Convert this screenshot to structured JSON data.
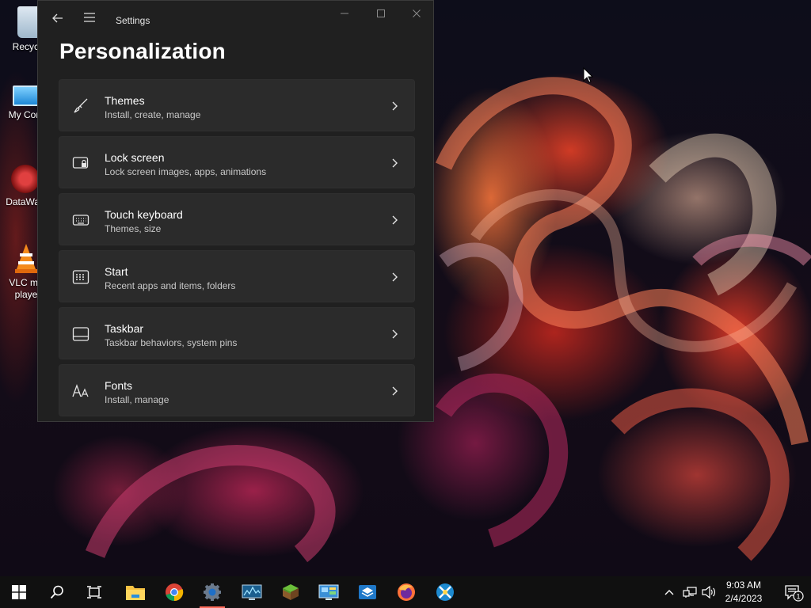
{
  "desktop": {
    "icons": [
      {
        "label": "Recycle",
        "icon": "recycle-bin-icon"
      },
      {
        "label": "My Com",
        "icon": "computer-icon"
      },
      {
        "label": "DataWag",
        "icon": "datawag-icon"
      },
      {
        "label": "VLC me\nplaye",
        "label_line1": "VLC me",
        "label_line2": "playe",
        "icon": "vlc-icon"
      }
    ]
  },
  "window": {
    "title": "Settings",
    "page_title": "Personalization",
    "controls": {
      "minimize": "minimize-icon",
      "maximize": "maximize-icon",
      "close": "close-icon"
    }
  },
  "settings": [
    {
      "title": "Themes",
      "subtitle": "Install, create, manage",
      "icon": "brush-icon"
    },
    {
      "title": "Lock screen",
      "subtitle": "Lock screen images, apps, animations",
      "icon": "lock-screen-icon"
    },
    {
      "title": "Touch keyboard",
      "subtitle": "Themes, size",
      "icon": "keyboard-icon"
    },
    {
      "title": "Start",
      "subtitle": "Recent apps and items, folders",
      "icon": "start-menu-icon"
    },
    {
      "title": "Taskbar",
      "subtitle": "Taskbar behaviors, system pins",
      "icon": "taskbar-icon"
    },
    {
      "title": "Fonts",
      "subtitle": "Install, manage",
      "icon": "fonts-icon"
    }
  ],
  "taskbar": {
    "apps": [
      {
        "name": "start-button",
        "icon": "windows-logo-icon"
      },
      {
        "name": "search-button",
        "icon": "search-icon"
      },
      {
        "name": "task-view-button",
        "icon": "task-view-icon"
      },
      {
        "name": "file-explorer",
        "icon": "folder-icon"
      },
      {
        "name": "chrome",
        "icon": "chrome-icon"
      },
      {
        "name": "settings",
        "icon": "gear-icon",
        "active": true
      },
      {
        "name": "resource-monitor",
        "icon": "monitor-chart-icon"
      },
      {
        "name": "minecraft",
        "icon": "grass-block-icon"
      },
      {
        "name": "control-panel",
        "icon": "control-panel-icon"
      },
      {
        "name": "package-app",
        "icon": "package-icon"
      },
      {
        "name": "firefox",
        "icon": "firefox-icon"
      },
      {
        "name": "tool-app",
        "icon": "compass-tool-icon"
      }
    ],
    "tray": {
      "time": "9:03 AM",
      "date": "2/4/2023",
      "notification_count": "1"
    }
  },
  "colors": {
    "window_bg": "#202020",
    "card_bg": "#2b2b2b",
    "taskbar_bg": "#101010",
    "accent_active": "#ff6b5a"
  }
}
